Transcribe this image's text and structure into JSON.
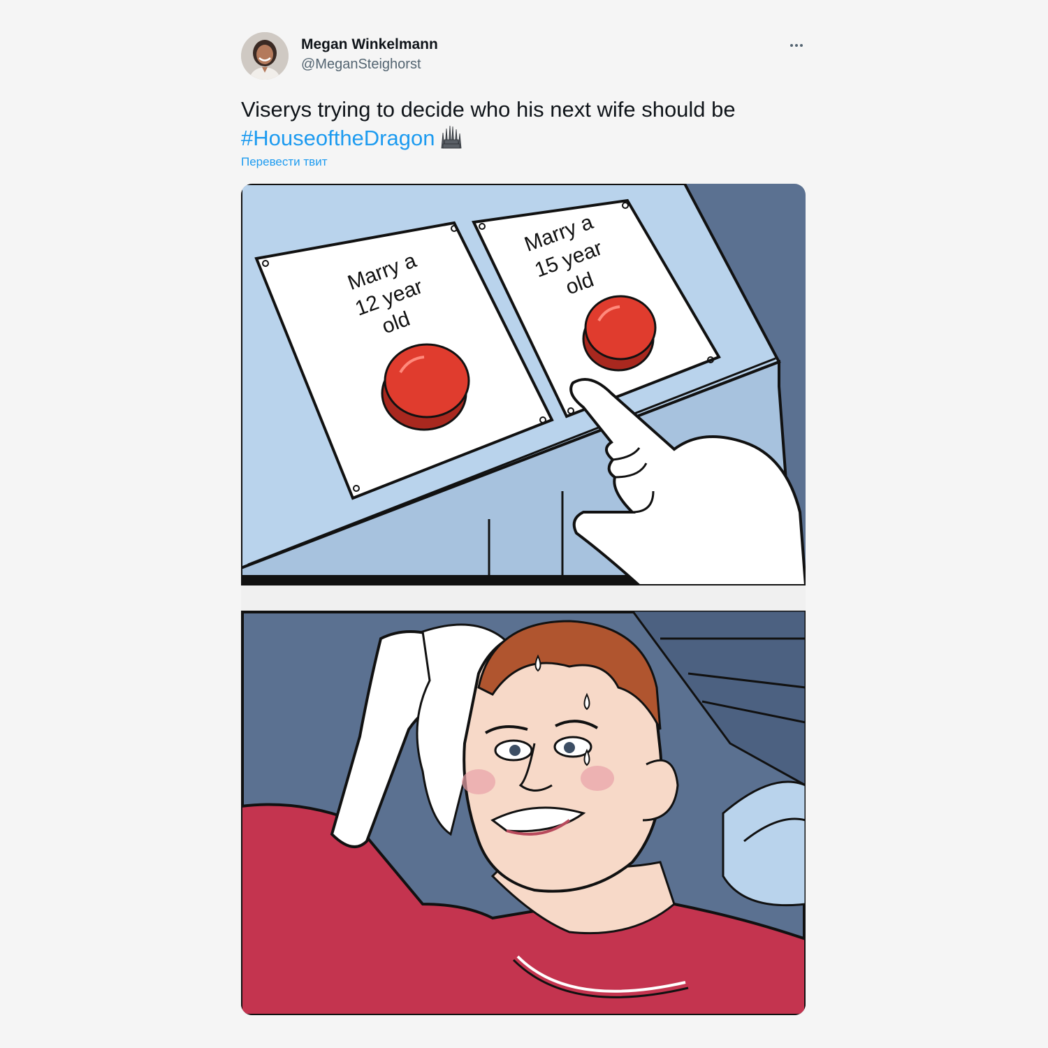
{
  "author": {
    "name": "Megan Winkelmann",
    "handle": "@MeganSteighorst"
  },
  "tweet": {
    "text": "Viserys trying to decide who his next wife should be",
    "hashtag": "#HouseoftheDragon",
    "translate_label": "Перевести твит"
  },
  "meme": {
    "left_button_label": [
      "Marry a",
      "12 year",
      "old"
    ],
    "right_button_label": [
      "Marry a",
      "15 year",
      "old"
    ]
  },
  "icons": {
    "more": "more-options-icon",
    "emoji": "iron-throne-emoji-icon"
  },
  "colors": {
    "link": "#1d9bf0",
    "text": "#0f1419",
    "secondary": "#536471",
    "button_red": "#e03c2e",
    "shirt_red": "#c4344f",
    "panel_blue": "#b9d3ec"
  }
}
